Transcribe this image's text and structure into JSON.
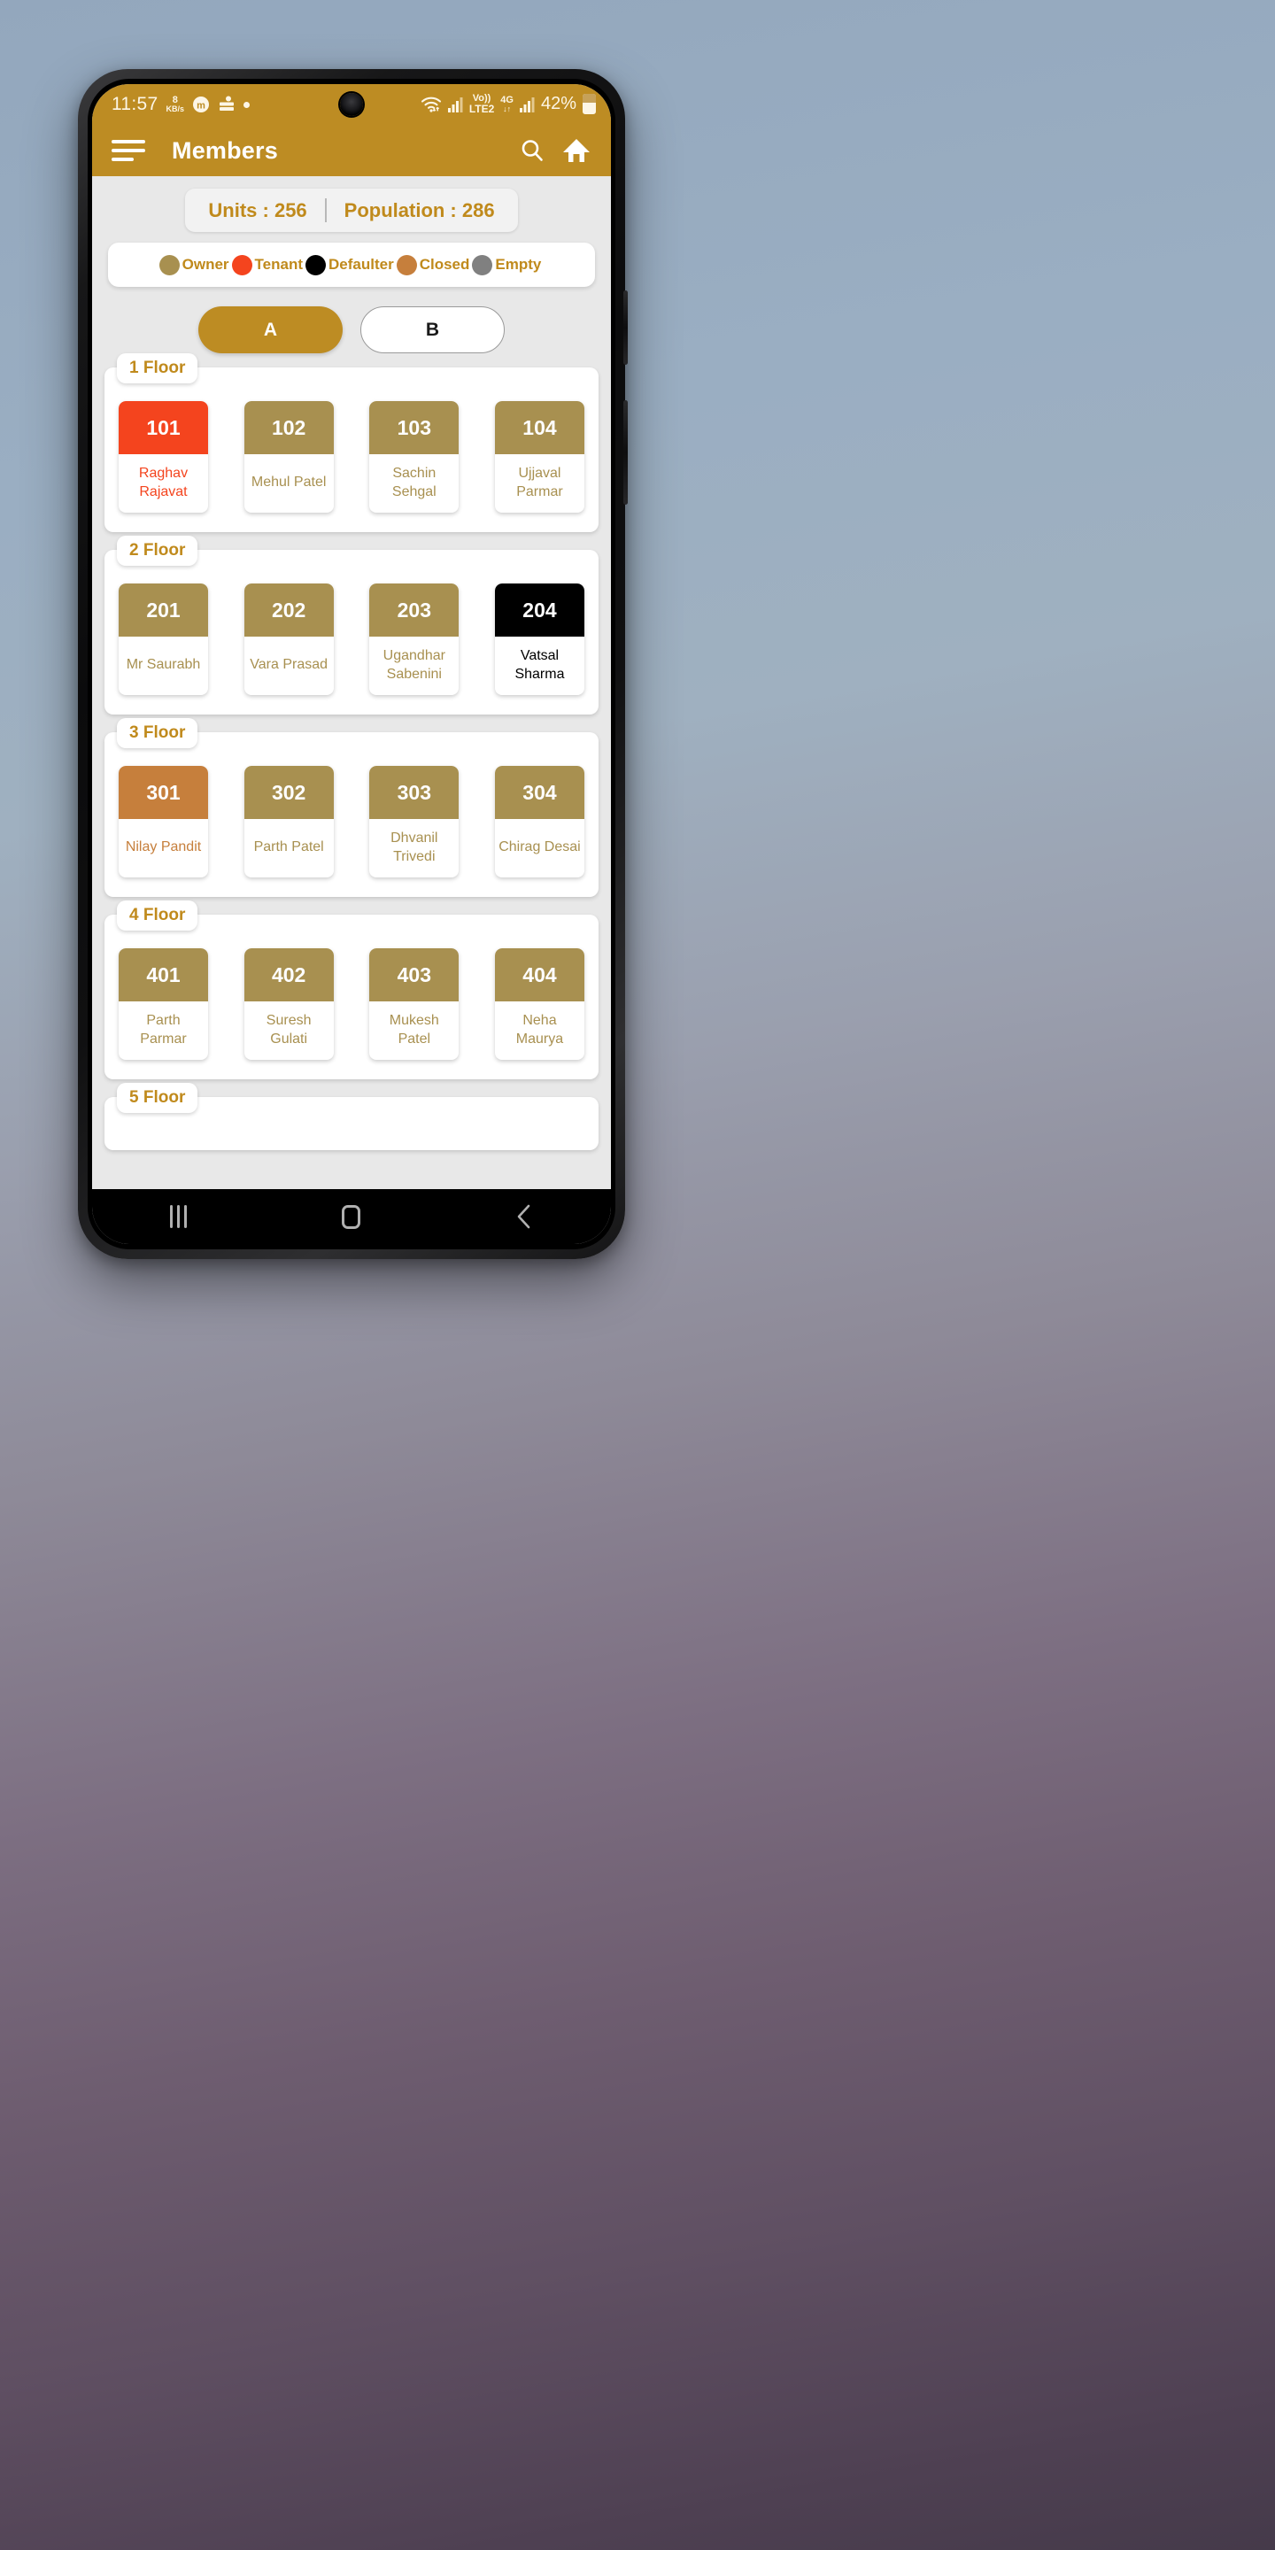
{
  "status_bar": {
    "time": "11:57",
    "net_speed_value": "8",
    "net_speed_unit": "KB/s",
    "volte_top": "Vo))",
    "volte_bottom": "LTE2",
    "network_type": "4G",
    "battery_percent": "42%"
  },
  "app_bar": {
    "title": "Members",
    "menu_icon": "hamburger-menu-icon",
    "search_icon": "search-icon",
    "home_icon": "home-icon"
  },
  "stats": {
    "units_label": "Units : 256",
    "population_label": "Population : 286"
  },
  "legend": {
    "items": [
      {
        "label": "Owner",
        "color": "#a89050"
      },
      {
        "label": "Tenant",
        "color": "#f4441e"
      },
      {
        "label": "Defaulter",
        "color": "#000000"
      },
      {
        "label": "Closed",
        "color": "#c67f3c"
      },
      {
        "label": "Empty",
        "color": "#808080"
      }
    ]
  },
  "tabs": [
    {
      "label": "A",
      "selected": true
    },
    {
      "label": "B",
      "selected": false
    }
  ],
  "colors": {
    "brand_gold": "#bd8c23",
    "owner": "#a89050",
    "tenant": "#f4441e",
    "defaulter": "#000000",
    "closed": "#c67f3c",
    "empty": "#808080",
    "text_gold": "#c08a1c",
    "page_bg": "#e8e8e8"
  },
  "floors": [
    {
      "label": "1 Floor",
      "units": [
        {
          "number": "101",
          "name": "Raghav Rajavat",
          "status": "Tenant",
          "color": "#f4441e"
        },
        {
          "number": "102",
          "name": "Mehul Patel",
          "status": "Owner",
          "color": "#a89050"
        },
        {
          "number": "103",
          "name": "Sachin Sehgal",
          "status": "Owner",
          "color": "#a89050"
        },
        {
          "number": "104",
          "name": "Ujjaval Parmar",
          "status": "Owner",
          "color": "#a89050"
        }
      ]
    },
    {
      "label": "2 Floor",
      "units": [
        {
          "number": "201",
          "name": "Mr Saurabh",
          "status": "Owner",
          "color": "#a89050"
        },
        {
          "number": "202",
          "name": "Vara Prasad",
          "status": "Owner",
          "color": "#a89050"
        },
        {
          "number": "203",
          "name": "Ugandhar Sabenini",
          "status": "Owner",
          "color": "#a89050"
        },
        {
          "number": "204",
          "name": "Vatsal Sharma",
          "status": "Defaulter",
          "color": "#000000"
        }
      ]
    },
    {
      "label": "3 Floor",
      "units": [
        {
          "number": "301",
          "name": "Nilay Pandit",
          "status": "Closed",
          "color": "#c67f3c"
        },
        {
          "number": "302",
          "name": "Parth Patel",
          "status": "Owner",
          "color": "#a89050"
        },
        {
          "number": "303",
          "name": "Dhvanil Trivedi",
          "status": "Owner",
          "color": "#a89050"
        },
        {
          "number": "304",
          "name": "Chirag Desai",
          "status": "Owner",
          "color": "#a89050"
        }
      ]
    },
    {
      "label": "4 Floor",
      "units": [
        {
          "number": "401",
          "name": "Parth Parmar",
          "status": "Owner",
          "color": "#a89050"
        },
        {
          "number": "402",
          "name": "Suresh Gulati",
          "status": "Owner",
          "color": "#a89050"
        },
        {
          "number": "403",
          "name": "Mukesh Patel",
          "status": "Owner",
          "color": "#a89050"
        },
        {
          "number": "404",
          "name": "Neha Maurya",
          "status": "Owner",
          "color": "#a89050"
        }
      ]
    },
    {
      "label": "5 Floor",
      "units": []
    }
  ],
  "nav_bar": {
    "recents_label": "recents-icon",
    "home_label": "home-icon",
    "back_label": "back-icon"
  }
}
